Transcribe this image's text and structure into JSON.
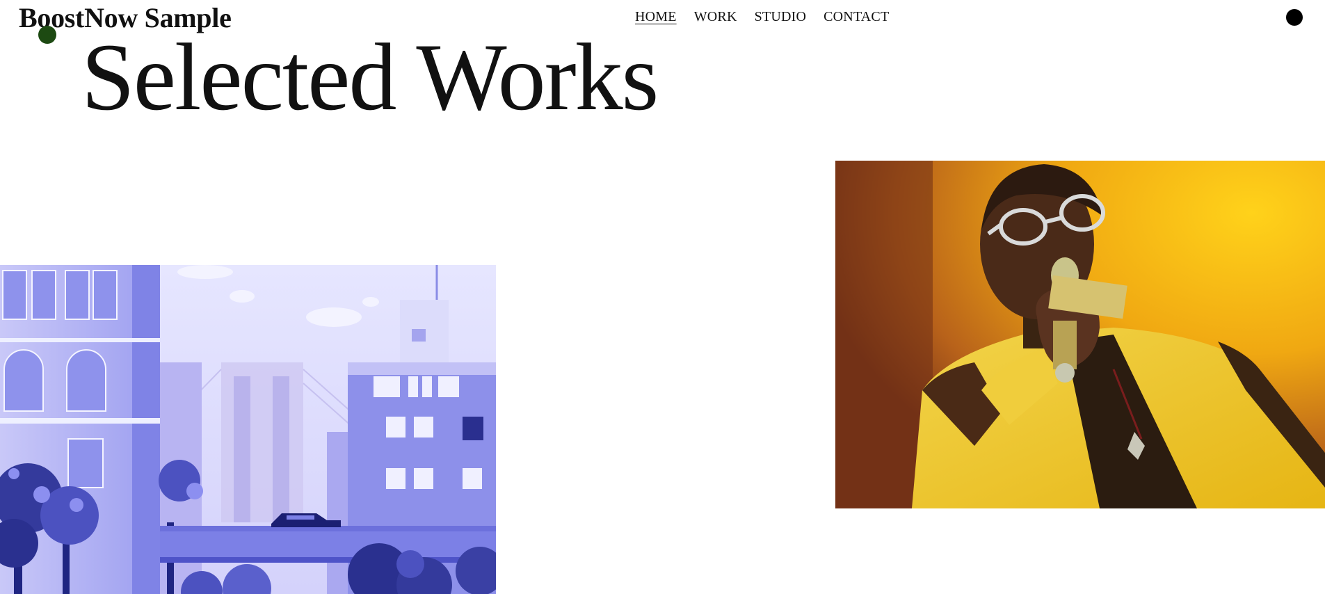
{
  "header": {
    "logo_text": "BoostNow Sample",
    "nav": [
      {
        "label": "HOME",
        "active": true
      },
      {
        "label": "WORK",
        "active": false
      },
      {
        "label": "STUDIO",
        "active": false
      },
      {
        "label": "CONTACT",
        "active": false
      }
    ]
  },
  "main": {
    "title": "Selected Works"
  },
  "colors": {
    "cursor_dot": "#1d4a12",
    "menu_dot": "#000000",
    "text": "#111111",
    "city_palette": [
      "#6f73e0",
      "#a9aaf3",
      "#e3e3ff",
      "#232a86"
    ],
    "singer_palette": [
      "#f4b400",
      "#c77a12",
      "#3b2410",
      "#e8c020"
    ]
  },
  "icons": {
    "menu": "menu-dot-icon",
    "cursor": "cursor-dot-icon"
  }
}
